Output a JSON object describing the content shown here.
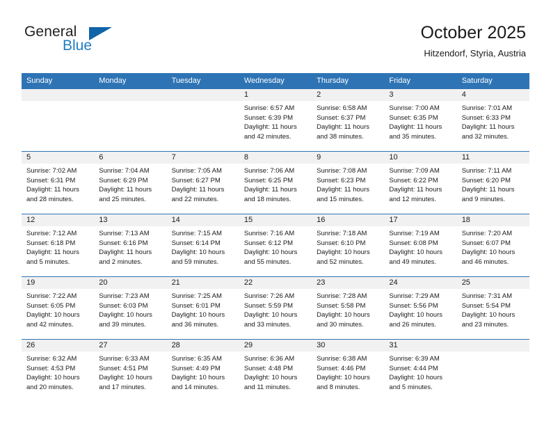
{
  "brand": {
    "line1": "General",
    "line2": "Blue",
    "triangle_color": "#1064a8",
    "blue_color": "#1f7cc4"
  },
  "header": {
    "title": "October 2025",
    "location": "Hitzendorf, Styria, Austria"
  },
  "theme": {
    "header_bar": "#2e74b5",
    "daynum_band": "#f1f1f1",
    "text": "#1a1a1a"
  },
  "calendar": {
    "weekday_headers": [
      "Sunday",
      "Monday",
      "Tuesday",
      "Wednesday",
      "Thursday",
      "Friday",
      "Saturday"
    ],
    "weeks": [
      [
        {
          "day": "",
          "sunrise": "",
          "sunset": "",
          "daylight1": "",
          "daylight2": "",
          "empty": true
        },
        {
          "day": "",
          "sunrise": "",
          "sunset": "",
          "daylight1": "",
          "daylight2": "",
          "empty": true
        },
        {
          "day": "",
          "sunrise": "",
          "sunset": "",
          "daylight1": "",
          "daylight2": "",
          "empty": true
        },
        {
          "day": "1",
          "sunrise": "Sunrise: 6:57 AM",
          "sunset": "Sunset: 6:39 PM",
          "daylight1": "Daylight: 11 hours",
          "daylight2": "and 42 minutes."
        },
        {
          "day": "2",
          "sunrise": "Sunrise: 6:58 AM",
          "sunset": "Sunset: 6:37 PM",
          "daylight1": "Daylight: 11 hours",
          "daylight2": "and 38 minutes."
        },
        {
          "day": "3",
          "sunrise": "Sunrise: 7:00 AM",
          "sunset": "Sunset: 6:35 PM",
          "daylight1": "Daylight: 11 hours",
          "daylight2": "and 35 minutes."
        },
        {
          "day": "4",
          "sunrise": "Sunrise: 7:01 AM",
          "sunset": "Sunset: 6:33 PM",
          "daylight1": "Daylight: 11 hours",
          "daylight2": "and 32 minutes."
        }
      ],
      [
        {
          "day": "5",
          "sunrise": "Sunrise: 7:02 AM",
          "sunset": "Sunset: 6:31 PM",
          "daylight1": "Daylight: 11 hours",
          "daylight2": "and 28 minutes."
        },
        {
          "day": "6",
          "sunrise": "Sunrise: 7:04 AM",
          "sunset": "Sunset: 6:29 PM",
          "daylight1": "Daylight: 11 hours",
          "daylight2": "and 25 minutes."
        },
        {
          "day": "7",
          "sunrise": "Sunrise: 7:05 AM",
          "sunset": "Sunset: 6:27 PM",
          "daylight1": "Daylight: 11 hours",
          "daylight2": "and 22 minutes."
        },
        {
          "day": "8",
          "sunrise": "Sunrise: 7:06 AM",
          "sunset": "Sunset: 6:25 PM",
          "daylight1": "Daylight: 11 hours",
          "daylight2": "and 18 minutes."
        },
        {
          "day": "9",
          "sunrise": "Sunrise: 7:08 AM",
          "sunset": "Sunset: 6:23 PM",
          "daylight1": "Daylight: 11 hours",
          "daylight2": "and 15 minutes."
        },
        {
          "day": "10",
          "sunrise": "Sunrise: 7:09 AM",
          "sunset": "Sunset: 6:22 PM",
          "daylight1": "Daylight: 11 hours",
          "daylight2": "and 12 minutes."
        },
        {
          "day": "11",
          "sunrise": "Sunrise: 7:11 AM",
          "sunset": "Sunset: 6:20 PM",
          "daylight1": "Daylight: 11 hours",
          "daylight2": "and 9 minutes."
        }
      ],
      [
        {
          "day": "12",
          "sunrise": "Sunrise: 7:12 AM",
          "sunset": "Sunset: 6:18 PM",
          "daylight1": "Daylight: 11 hours",
          "daylight2": "and 5 minutes."
        },
        {
          "day": "13",
          "sunrise": "Sunrise: 7:13 AM",
          "sunset": "Sunset: 6:16 PM",
          "daylight1": "Daylight: 11 hours",
          "daylight2": "and 2 minutes."
        },
        {
          "day": "14",
          "sunrise": "Sunrise: 7:15 AM",
          "sunset": "Sunset: 6:14 PM",
          "daylight1": "Daylight: 10 hours",
          "daylight2": "and 59 minutes."
        },
        {
          "day": "15",
          "sunrise": "Sunrise: 7:16 AM",
          "sunset": "Sunset: 6:12 PM",
          "daylight1": "Daylight: 10 hours",
          "daylight2": "and 55 minutes."
        },
        {
          "day": "16",
          "sunrise": "Sunrise: 7:18 AM",
          "sunset": "Sunset: 6:10 PM",
          "daylight1": "Daylight: 10 hours",
          "daylight2": "and 52 minutes."
        },
        {
          "day": "17",
          "sunrise": "Sunrise: 7:19 AM",
          "sunset": "Sunset: 6:08 PM",
          "daylight1": "Daylight: 10 hours",
          "daylight2": "and 49 minutes."
        },
        {
          "day": "18",
          "sunrise": "Sunrise: 7:20 AM",
          "sunset": "Sunset: 6:07 PM",
          "daylight1": "Daylight: 10 hours",
          "daylight2": "and 46 minutes."
        }
      ],
      [
        {
          "day": "19",
          "sunrise": "Sunrise: 7:22 AM",
          "sunset": "Sunset: 6:05 PM",
          "daylight1": "Daylight: 10 hours",
          "daylight2": "and 42 minutes."
        },
        {
          "day": "20",
          "sunrise": "Sunrise: 7:23 AM",
          "sunset": "Sunset: 6:03 PM",
          "daylight1": "Daylight: 10 hours",
          "daylight2": "and 39 minutes."
        },
        {
          "day": "21",
          "sunrise": "Sunrise: 7:25 AM",
          "sunset": "Sunset: 6:01 PM",
          "daylight1": "Daylight: 10 hours",
          "daylight2": "and 36 minutes."
        },
        {
          "day": "22",
          "sunrise": "Sunrise: 7:26 AM",
          "sunset": "Sunset: 5:59 PM",
          "daylight1": "Daylight: 10 hours",
          "daylight2": "and 33 minutes."
        },
        {
          "day": "23",
          "sunrise": "Sunrise: 7:28 AM",
          "sunset": "Sunset: 5:58 PM",
          "daylight1": "Daylight: 10 hours",
          "daylight2": "and 30 minutes."
        },
        {
          "day": "24",
          "sunrise": "Sunrise: 7:29 AM",
          "sunset": "Sunset: 5:56 PM",
          "daylight1": "Daylight: 10 hours",
          "daylight2": "and 26 minutes."
        },
        {
          "day": "25",
          "sunrise": "Sunrise: 7:31 AM",
          "sunset": "Sunset: 5:54 PM",
          "daylight1": "Daylight: 10 hours",
          "daylight2": "and 23 minutes."
        }
      ],
      [
        {
          "day": "26",
          "sunrise": "Sunrise: 6:32 AM",
          "sunset": "Sunset: 4:53 PM",
          "daylight1": "Daylight: 10 hours",
          "daylight2": "and 20 minutes."
        },
        {
          "day": "27",
          "sunrise": "Sunrise: 6:33 AM",
          "sunset": "Sunset: 4:51 PM",
          "daylight1": "Daylight: 10 hours",
          "daylight2": "and 17 minutes."
        },
        {
          "day": "28",
          "sunrise": "Sunrise: 6:35 AM",
          "sunset": "Sunset: 4:49 PM",
          "daylight1": "Daylight: 10 hours",
          "daylight2": "and 14 minutes."
        },
        {
          "day": "29",
          "sunrise": "Sunrise: 6:36 AM",
          "sunset": "Sunset: 4:48 PM",
          "daylight1": "Daylight: 10 hours",
          "daylight2": "and 11 minutes."
        },
        {
          "day": "30",
          "sunrise": "Sunrise: 6:38 AM",
          "sunset": "Sunset: 4:46 PM",
          "daylight1": "Daylight: 10 hours",
          "daylight2": "and 8 minutes."
        },
        {
          "day": "31",
          "sunrise": "Sunrise: 6:39 AM",
          "sunset": "Sunset: 4:44 PM",
          "daylight1": "Daylight: 10 hours",
          "daylight2": "and 5 minutes."
        },
        {
          "day": "",
          "sunrise": "",
          "sunset": "",
          "daylight1": "",
          "daylight2": "",
          "empty": true
        }
      ]
    ]
  }
}
